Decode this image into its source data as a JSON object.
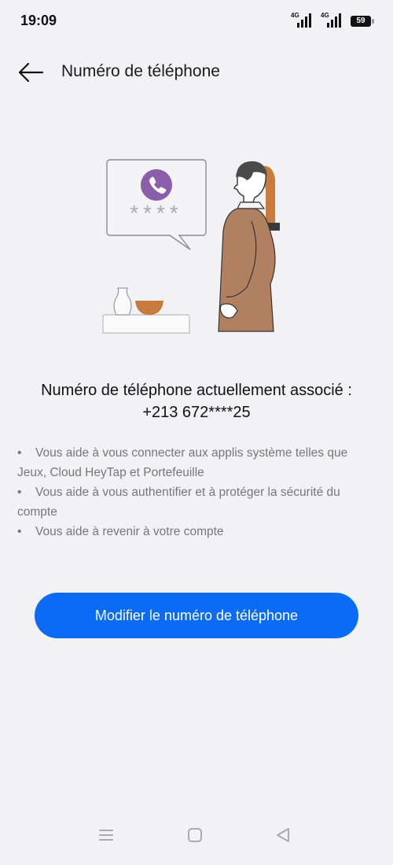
{
  "status_bar": {
    "time": "19:09",
    "network_1": "4G",
    "network_2": "4G",
    "battery": "59"
  },
  "header": {
    "title": "Numéro de téléphone",
    "back_icon": "arrow-left-icon"
  },
  "illustration": {
    "masked_code": "****"
  },
  "info": {
    "heading": "Numéro de téléphone actuellement associé :",
    "phone_number": "+213 672****25",
    "bullets": [
      {
        "marker": "•",
        "text": "Vous aide à vous connecter aux applis système telles que Jeux, Cloud HeyTap et Portefeuille"
      },
      {
        "marker": "•",
        "text": "Vous aide à vous authentifier et à protéger la sécurité du compte"
      },
      {
        "marker": "•",
        "text": "Vous aide à revenir à votre compte"
      }
    ]
  },
  "primary_button": {
    "label": "Modifier le numéro de téléphone",
    "color": "#0a6cf5"
  },
  "nav_bar": {
    "recents_icon": "menu-icon",
    "home_icon": "square-home-icon",
    "back_icon": "triangle-back-icon"
  }
}
